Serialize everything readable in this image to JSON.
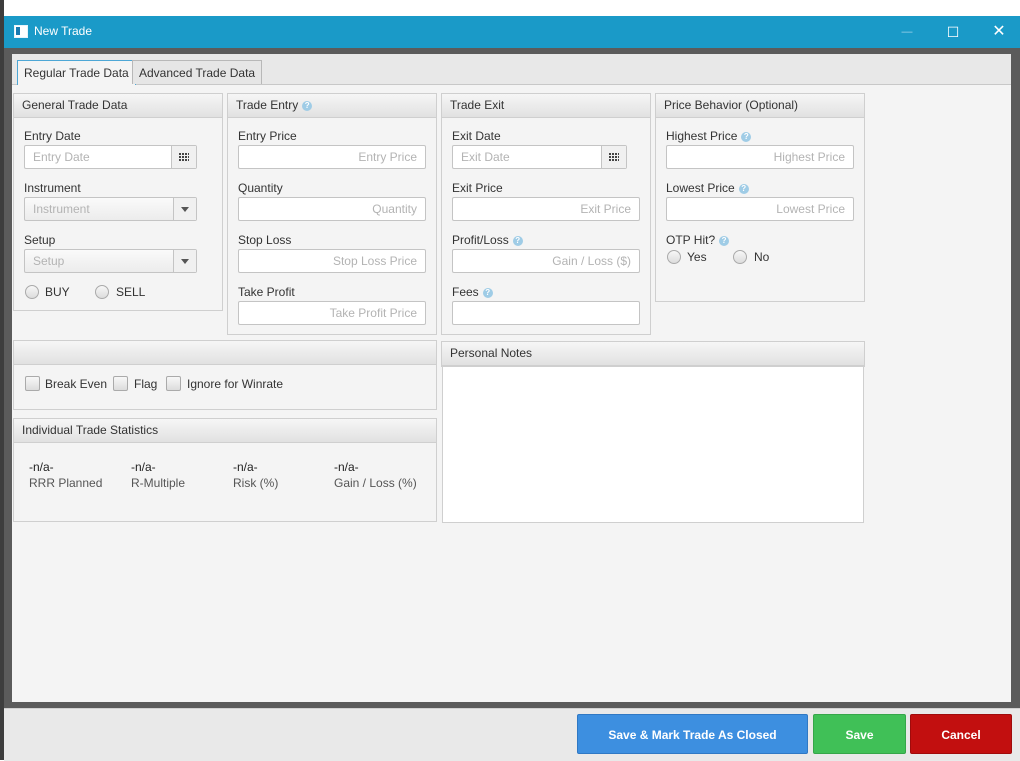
{
  "window": {
    "title": "New Trade",
    "minimize": "—",
    "maximize": "☐",
    "close": "✕"
  },
  "tabs": [
    {
      "label": "Regular Trade Data",
      "active": true
    },
    {
      "label": "Advanced Trade Data",
      "active": false
    }
  ],
  "general": {
    "title": "General Trade Data",
    "entry_date_label": "Entry Date",
    "entry_date_placeholder": "Entry Date",
    "instrument_label": "Instrument",
    "instrument_placeholder": "Instrument",
    "setup_label": "Setup",
    "setup_placeholder": "Setup",
    "buy": "BUY",
    "sell": "SELL"
  },
  "entry": {
    "title": "Trade Entry",
    "entry_price_label": "Entry Price",
    "entry_price_placeholder": "Entry Price",
    "quantity_label": "Quantity",
    "quantity_placeholder": "Quantity",
    "stop_loss_label": "Stop Loss",
    "stop_loss_placeholder": "Stop Loss Price",
    "take_profit_label": "Take Profit",
    "take_profit_placeholder": "Take Profit Price"
  },
  "exit": {
    "title": "Trade Exit",
    "exit_date_label": "Exit Date",
    "exit_date_placeholder": "Exit Date",
    "exit_price_label": "Exit Price",
    "exit_price_placeholder": "Exit Price",
    "profit_loss_label": "Profit/Loss",
    "profit_loss_placeholder": "Gain / Loss ($)",
    "fees_label": "Fees",
    "fees_value": ""
  },
  "price_behavior": {
    "title": "Price Behavior (Optional)",
    "highest_label": "Highest Price",
    "highest_placeholder": "Highest Price",
    "lowest_label": "Lowest Price",
    "lowest_placeholder": "Lowest Price",
    "otp_label": "OTP Hit?",
    "yes": "Yes",
    "no": "No"
  },
  "flags": {
    "break_even": "Break Even",
    "flag": "Flag",
    "ignore_winrate": "Ignore for Winrate"
  },
  "notes": {
    "title": "Personal Notes",
    "value": ""
  },
  "stats": {
    "title": "Individual Trade Statistics",
    "items": [
      {
        "value": "-n/a-",
        "label": "RRR Planned"
      },
      {
        "value": "-n/a-",
        "label": "R-Multiple"
      },
      {
        "value": "-n/a-",
        "label": "Risk (%)"
      },
      {
        "value": "-n/a-",
        "label": "Gain / Loss (%)"
      }
    ]
  },
  "help_glyph": "?",
  "buttons": {
    "save_close": "Save & Mark Trade As Closed",
    "save": "Save",
    "cancel": "Cancel"
  },
  "colors": {
    "titlebar": "#1a9ac8",
    "save_close": "#3d8fe0",
    "save": "#40c057",
    "cancel": "#c20f0f"
  }
}
